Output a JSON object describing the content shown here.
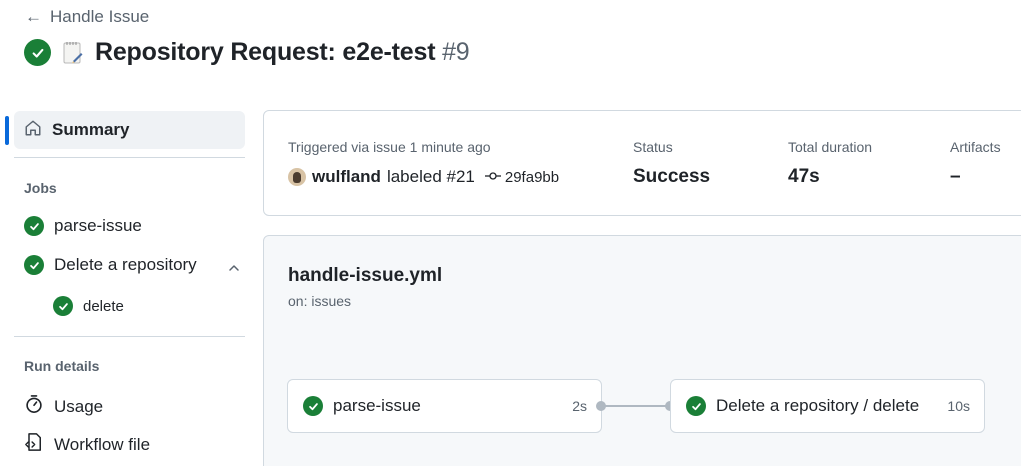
{
  "header": {
    "back_label": "Handle Issue",
    "title": "Repository Request: e2e-test",
    "run_number": "#9",
    "status_icon": "check-circle-fill",
    "title_emoji": "memo-icon"
  },
  "sidebar": {
    "summary_label": "Summary",
    "jobs_heading": "Jobs",
    "jobs": [
      {
        "label": "parse-issue",
        "status": "success"
      },
      {
        "label": "Delete a repository",
        "status": "success",
        "expanded": true,
        "steps": [
          {
            "label": "delete",
            "status": "success"
          }
        ]
      }
    ],
    "run_details_heading": "Run details",
    "run_details": [
      {
        "label": "Usage",
        "icon": "stopwatch-icon"
      },
      {
        "label": "Workflow file",
        "icon": "file-code-icon"
      }
    ]
  },
  "summary": {
    "triggered_label": "Triggered via issue 1 minute ago",
    "user": "wulfland",
    "action_text": "labeled #21",
    "commit": "29fa9bb",
    "status_label": "Status",
    "status_value": "Success",
    "duration_label": "Total duration",
    "duration_value": "47s",
    "artifacts_label": "Artifacts",
    "artifacts_value": "–"
  },
  "workflow": {
    "file_name": "handle-issue.yml",
    "trigger": "on: issues",
    "jobs": [
      {
        "name": "parse-issue",
        "duration": "2s",
        "status": "success"
      },
      {
        "name": "Delete a repository / delete",
        "duration": "10s",
        "status": "success"
      }
    ]
  },
  "colors": {
    "success": "#1a7f37",
    "accent": "#0969da",
    "muted_text": "#59636e",
    "border": "#d1d9e0"
  }
}
